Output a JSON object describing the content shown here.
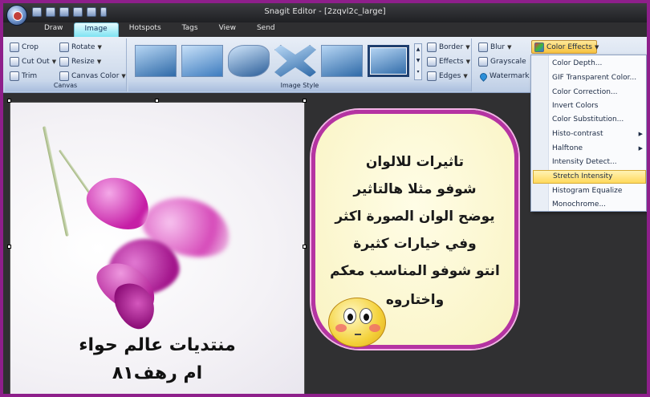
{
  "window": {
    "title": "Snagit Editor - [2zqvl2c_large]"
  },
  "tabs": [
    {
      "label": "Draw",
      "active": false
    },
    {
      "label": "Image",
      "active": true
    },
    {
      "label": "Hotspots",
      "active": false
    },
    {
      "label": "Tags",
      "active": false
    },
    {
      "label": "View",
      "active": false
    },
    {
      "label": "Send",
      "active": false
    }
  ],
  "ribbon": {
    "canvas": {
      "label": "Canvas",
      "crop": "Crop",
      "cutout": "Cut Out",
      "trim": "Trim",
      "rotate": "Rotate",
      "resize": "Resize",
      "canvas_color": "Canvas Color"
    },
    "image_style": {
      "label": "Image Style",
      "border": "Border",
      "effects": "Effects",
      "edges": "Edges"
    },
    "modify": {
      "blur": "Blur",
      "grayscale": "Grayscale",
      "watermark": "Watermark",
      "color_effects": "Color Effects"
    }
  },
  "menu": {
    "items": [
      {
        "label": "Color Depth...",
        "submenu": false,
        "highlighted": false
      },
      {
        "label": "GIF Transparent Color...",
        "submenu": false,
        "highlighted": false
      },
      {
        "label": "Color Correction...",
        "submenu": false,
        "highlighted": false
      },
      {
        "label": "Invert Colors",
        "submenu": false,
        "highlighted": false
      },
      {
        "label": "Color Substitution...",
        "submenu": false,
        "highlighted": false
      },
      {
        "label": "Histo-contrast",
        "submenu": true,
        "highlighted": false
      },
      {
        "label": "Halftone",
        "submenu": true,
        "highlighted": false
      },
      {
        "label": "Intensity Detect...",
        "submenu": false,
        "highlighted": false
      },
      {
        "label": "Stretch Intensity",
        "submenu": false,
        "highlighted": true
      },
      {
        "label": "Histogram Equalize",
        "submenu": false,
        "highlighted": false
      },
      {
        "label": "Monochrome...",
        "submenu": false,
        "highlighted": false
      }
    ]
  },
  "image_caption": {
    "line1": "منتديات عالم حواء",
    "line2": "ام رهف٨١"
  },
  "bubble": {
    "lines": [
      "تاثيرات للالوان",
      "شوفو مثلا هالتاثير",
      "يوضح الوان الصورة اكثر",
      "وفي خيارات كثيرة",
      "انتو شوفو المناسب معكم",
      "واختاروه"
    ]
  },
  "colors": {
    "frame": "#8e1f8b",
    "bubble_border": "#b533a2",
    "highlight": "#ffd95c",
    "active_tab": "#7ee3f2"
  }
}
